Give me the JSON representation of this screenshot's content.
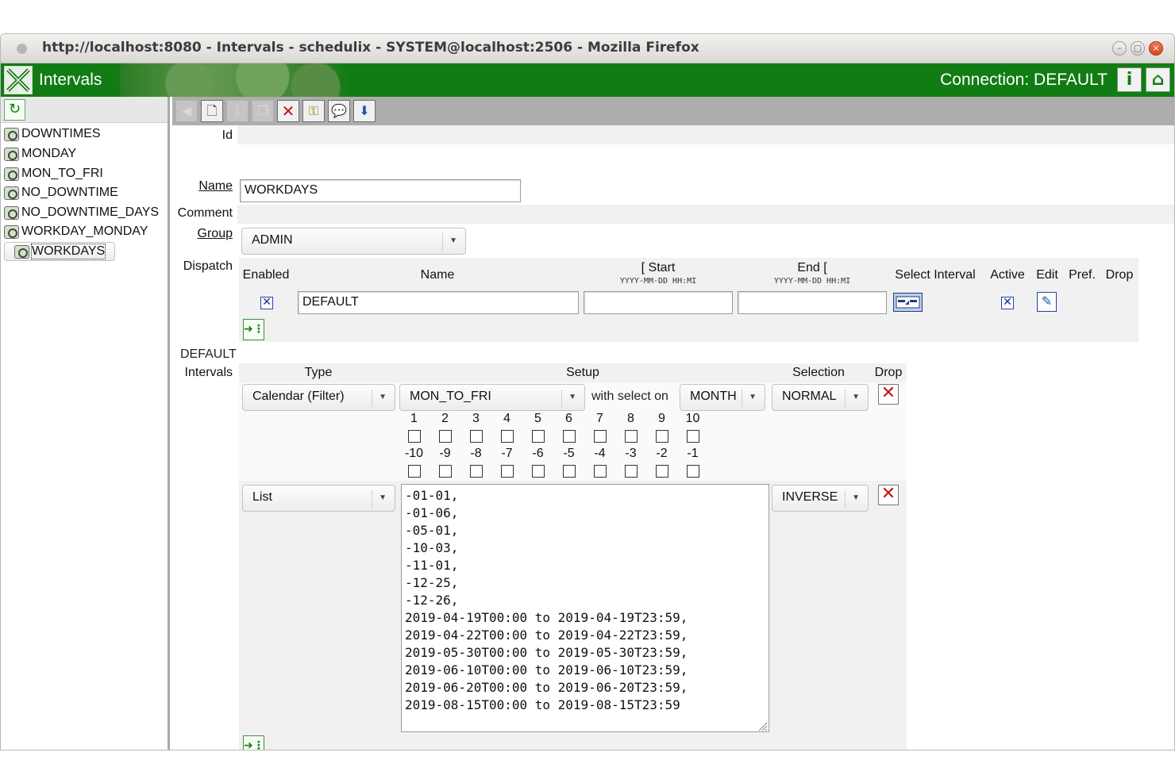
{
  "window": {
    "title": "http://localhost:8080 - Intervals - schedulix - SYSTEM@localhost:2506 - Mozilla Firefox",
    "minimize": "–",
    "maximize": "▢",
    "close": "×"
  },
  "app": {
    "name": "Intervals",
    "connection_label": "Connection:",
    "connection_value": "DEFAULT",
    "info_icon": "i",
    "home_icon": "⌂"
  },
  "tree": {
    "items": [
      "DOWNTIMES",
      "MONDAY",
      "MON_TO_FRI",
      "NO_DOWNTIME",
      "NO_DOWNTIME_DAYS",
      "WORKDAY_MONDAY",
      "WORKDAYS"
    ],
    "selected": "WORKDAYS"
  },
  "form": {
    "id_label": "Id",
    "name_label": "Name",
    "name_value": "WORKDAYS",
    "comment_label": "Comment",
    "group_label": "Group",
    "group_value": "ADMIN",
    "dispatch_label": "Dispatch"
  },
  "dispatch": {
    "headers": {
      "enabled": "Enabled",
      "name": "Name",
      "start": "[ Start",
      "start_fmt": "YYYY-MM-DD HH:MI",
      "end": "End [",
      "end_fmt": "YYYY-MM-DD HH:MI",
      "select_interval": "Select Interval",
      "active": "Active",
      "edit": "Edit",
      "pref": "Pref.",
      "drop": "Drop"
    },
    "row": {
      "enabled": true,
      "name": "DEFAULT",
      "start": "",
      "end": "",
      "active": true
    }
  },
  "intervals": {
    "section_title": "DEFAULT",
    "label": "Intervals",
    "headers": {
      "type": "Type",
      "setup": "Setup",
      "selection": "Selection",
      "drop": "Drop"
    },
    "rows": [
      {
        "type": "Calendar (Filter)",
        "setup_value": "MON_TO_FRI",
        "with_select_on": "with select on",
        "period": "MONTH",
        "selection": "NORMAL",
        "positive": [
          "1",
          "2",
          "3",
          "4",
          "5",
          "6",
          "7",
          "8",
          "9",
          "10"
        ],
        "negative": [
          "-10",
          "-9",
          "-8",
          "-7",
          "-6",
          "-5",
          "-4",
          "-3",
          "-2",
          "-1"
        ]
      },
      {
        "type": "List",
        "selection": "INVERSE",
        "list_text": "-01-01,\n-01-06,\n-05-01,\n-10-03,\n-11-01,\n-12-25,\n-12-26,\n2019-04-19T00:00 to 2019-04-19T23:59,\n2019-04-22T00:00 to 2019-04-22T23:59,\n2019-05-30T00:00 to 2019-05-30T23:59,\n2019-06-10T00:00 to 2019-06-10T23:59,\n2019-06-20T00:00 to 2019-06-20T23:59,\n2019-08-15T00:00 to 2019-08-15T23:59"
      }
    ]
  },
  "colors": {
    "header_green": "#127c14",
    "toolbar_gray": "#adadad",
    "drop_red": "#c41414"
  }
}
